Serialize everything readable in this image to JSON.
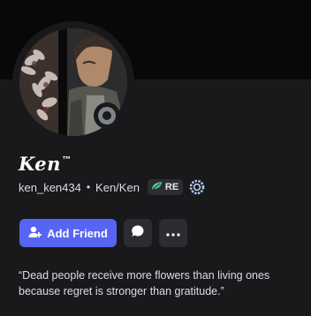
{
  "profile": {
    "display_name": "Ken",
    "display_name_suffix": "™",
    "username": "ken_ken434",
    "pronouns": "Ken/Ken",
    "guild_tag": "RE",
    "status": "offline",
    "bio_line1": "“Dead people receive more flowers than living ones",
    "bio_line2": "because regret is stronger than gratitude.”"
  },
  "actions": {
    "add_friend_label": "Add Friend"
  },
  "icons": {
    "status": "offline-status-icon",
    "guild_tag": "leaf-icon",
    "badge": "gear-badge-icon",
    "add_friend": "add-user-icon",
    "message": "chat-bubble-icon",
    "more": "ellipsis-icon"
  },
  "colors": {
    "background": "#19191c",
    "banner": "#080808",
    "primary_button": "#5865f2",
    "secondary_button": "#2b2d31",
    "status_offline": "#80848e",
    "badge_blue": "#a9c8ff"
  }
}
